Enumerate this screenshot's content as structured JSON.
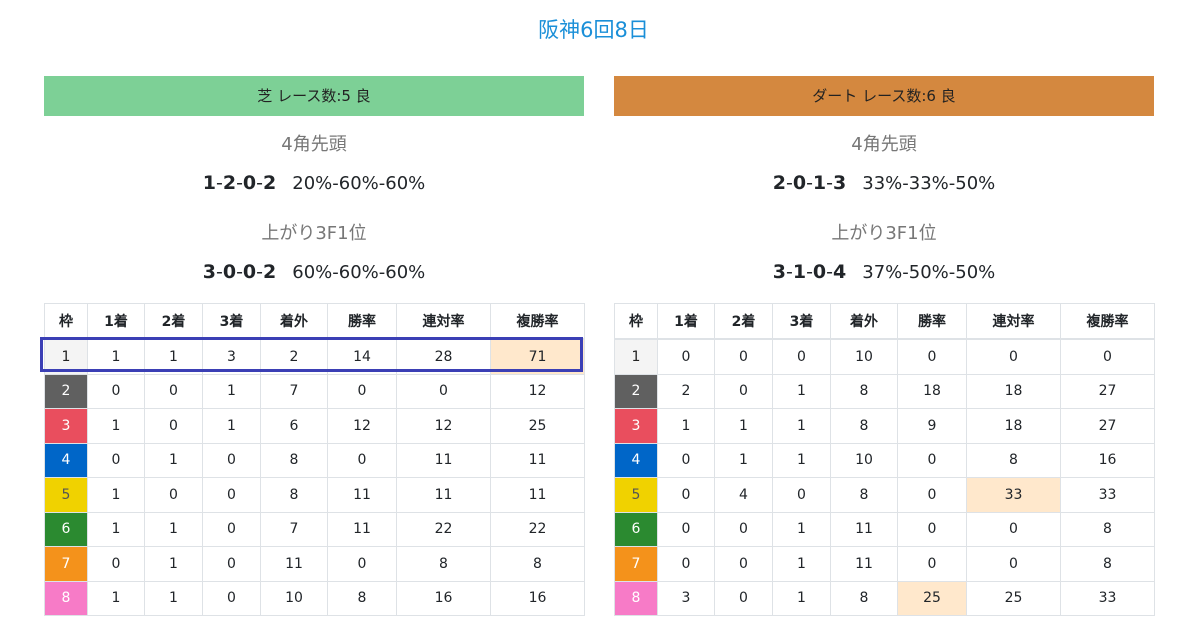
{
  "page_title": "阪神6回8日",
  "colors": {
    "title": "#1a8fd8",
    "turf_header": "#7dd096",
    "dirt_header": "#d4883f",
    "highlight_cell": "#ffe8cc",
    "highlight_box": "#3b3fb5"
  },
  "frame_colors": [
    "#f4f4f4",
    "#606060",
    "#e94e5e",
    "#0066c8",
    "#f0d200",
    "#2b8a30",
    "#f4921b",
    "#f77bc7"
  ],
  "frame_text_colors": [
    "#222222",
    "#ffffff",
    "#ffffff",
    "#ffffff",
    "#555555",
    "#ffffff",
    "#ffffff",
    "#ffffff"
  ],
  "panels": [
    {
      "header": "芝 レース数:5  良",
      "corner_label": "4角先頭",
      "corner_score": [
        "1",
        "2",
        "0",
        "2"
      ],
      "corner_rates": "20%-60%-60%",
      "last3f_label": "上がり3F1位",
      "last3f_score": [
        "3",
        "0",
        "0",
        "2"
      ],
      "last3f_rates": "60%-60%-60%",
      "columns": [
        "枠",
        "1着",
        "2着",
        "3着",
        "着外",
        "勝率",
        "連対率",
        "複勝率"
      ],
      "rows": [
        [
          "1",
          "1",
          "1",
          "3",
          "2",
          "14",
          "28",
          "71"
        ],
        [
          "2",
          "0",
          "0",
          "1",
          "7",
          "0",
          "0",
          "12"
        ],
        [
          "3",
          "1",
          "0",
          "1",
          "6",
          "12",
          "12",
          "25"
        ],
        [
          "4",
          "0",
          "1",
          "0",
          "8",
          "0",
          "11",
          "11"
        ],
        [
          "5",
          "1",
          "0",
          "0",
          "8",
          "11",
          "11",
          "11"
        ],
        [
          "6",
          "1",
          "1",
          "0",
          "7",
          "11",
          "22",
          "22"
        ],
        [
          "7",
          "0",
          "1",
          "0",
          "11",
          "0",
          "8",
          "8"
        ],
        [
          "8",
          "1",
          "1",
          "0",
          "10",
          "8",
          "16",
          "16"
        ]
      ],
      "highlight_cells": [
        [
          0,
          7
        ]
      ]
    },
    {
      "header": "ダート レース数:6  良",
      "corner_label": "4角先頭",
      "corner_score": [
        "2",
        "0",
        "1",
        "3"
      ],
      "corner_rates": "33%-33%-50%",
      "last3f_label": "上がり3F1位",
      "last3f_score": [
        "3",
        "1",
        "0",
        "4"
      ],
      "last3f_rates": "37%-50%-50%",
      "columns": [
        "枠",
        "1着",
        "2着",
        "3着",
        "着外",
        "勝率",
        "連対率",
        "複勝率"
      ],
      "rows": [
        [
          "1",
          "0",
          "0",
          "0",
          "10",
          "0",
          "0",
          "0"
        ],
        [
          "2",
          "2",
          "0",
          "1",
          "8",
          "18",
          "18",
          "27"
        ],
        [
          "3",
          "1",
          "1",
          "1",
          "8",
          "9",
          "18",
          "27"
        ],
        [
          "4",
          "0",
          "1",
          "1",
          "10",
          "0",
          "8",
          "16"
        ],
        [
          "5",
          "0",
          "4",
          "0",
          "8",
          "0",
          "33",
          "33"
        ],
        [
          "6",
          "0",
          "0",
          "1",
          "11",
          "0",
          "0",
          "8"
        ],
        [
          "7",
          "0",
          "0",
          "1",
          "11",
          "0",
          "0",
          "8"
        ],
        [
          "8",
          "3",
          "0",
          "1",
          "8",
          "25",
          "25",
          "33"
        ]
      ],
      "highlight_cells": [
        [
          4,
          6
        ],
        [
          7,
          5
        ]
      ]
    }
  ]
}
